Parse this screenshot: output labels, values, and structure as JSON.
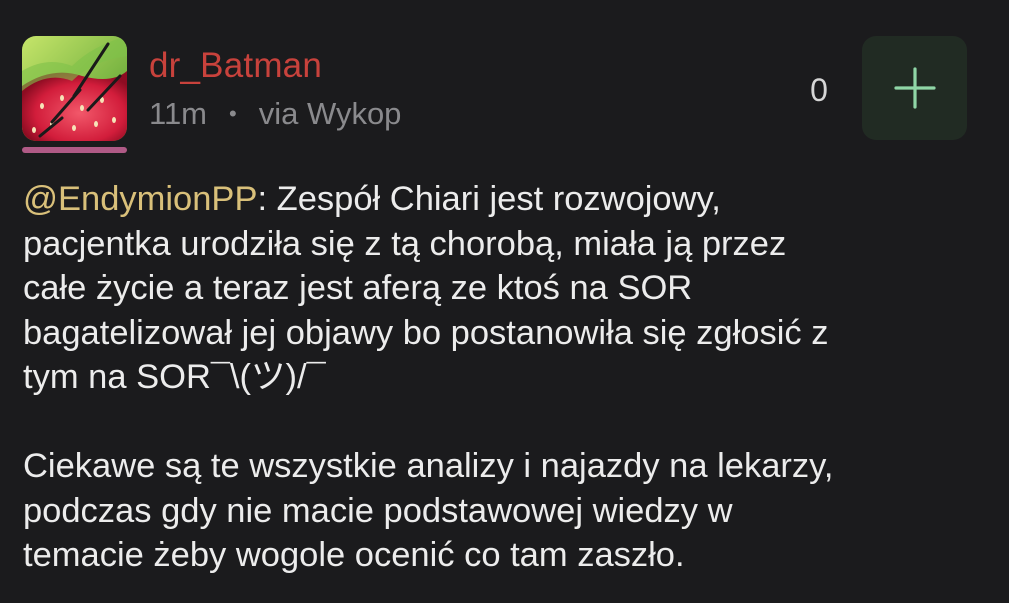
{
  "comment": {
    "author": "dr_Batman",
    "time": "11m",
    "separator": "•",
    "via": "via Wykop",
    "votes": "0",
    "mention": "@EndymionPP",
    "body_lines_1": [
      ": Zespół Chiari jest rozwojowy,",
      "pacjentka urodziła się z tą chorobą, miała ją przez",
      "całe życie a teraz jest aferą ze ktoś na SOR",
      "bagatelizował jej objawy bo postanowiła się zgłosić z",
      "tym na SOR¯\\(ツ)/¯"
    ],
    "body_lines_2": [
      "Ciekawe są te wszystkie analizy i najazdy na lekarzy,",
      "podczas gdy nie macie podstawowej wiedzy w",
      "temacie żeby wogole ocenić co tam zaszło."
    ]
  },
  "icons": {
    "avatar": "strawberry-avatar",
    "plus": "plus-icon"
  },
  "colors": {
    "background": "#1b1b1d",
    "author": "#c8423c",
    "meta": "#8a8a8d",
    "mention": "#d9c07a",
    "text": "#ececec",
    "votes": "#d6d6d6",
    "plus_button_bg": "#212b23",
    "plus_icon": "#8fd6a6",
    "avatar_bar": "#b05a86"
  }
}
